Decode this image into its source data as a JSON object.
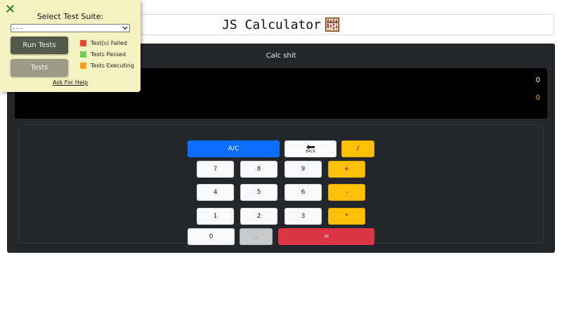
{
  "header": {
    "title": "JS Calculator",
    "logo_icon": "abacus-icon"
  },
  "calculator": {
    "title": "Calc shit",
    "display": {
      "main": "0",
      "sub": "0"
    },
    "keys": {
      "clear": "A/C",
      "back": "BACK",
      "divide": "/",
      "plus": "+",
      "minus": "-",
      "multiply": "*",
      "seven": "7",
      "eight": "8",
      "nine": "9",
      "four": "4",
      "five": "5",
      "six": "6",
      "one": "1",
      "two": "2",
      "three": "3",
      "zero": "0",
      "decimal": ".",
      "equals": "="
    }
  },
  "test_panel": {
    "select_label": "Select Test Suite:",
    "selected_suite": "- - -",
    "run_button": "Run Tests",
    "tests_button": "Tests",
    "legend": {
      "failed": "Test(s) Failed",
      "passed": "Tests Passed",
      "executing": "Tests Executing"
    },
    "help_link": "Ask For Help"
  },
  "colors": {
    "failed": "#f44336",
    "passed": "#66d45b",
    "executing": "#ff9f1a",
    "accent_blue": "#0d6efd",
    "accent_yellow": "#ffc107",
    "accent_red": "#dc3545",
    "calc_bg": "#23262b",
    "panel_bg": "#f5f3c1"
  }
}
